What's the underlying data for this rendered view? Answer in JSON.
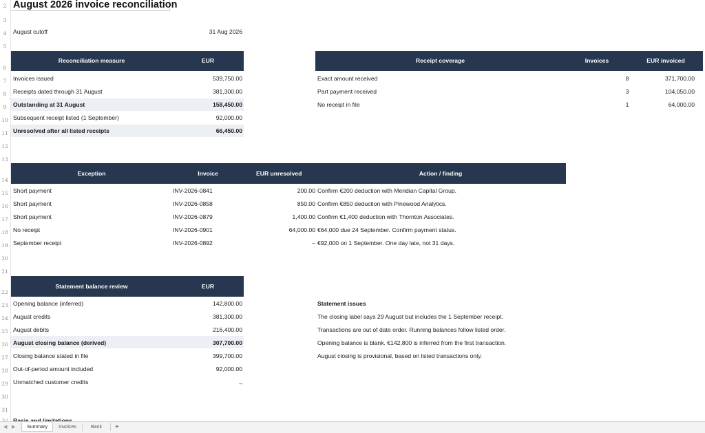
{
  "title": "August 2026 invoice reconciliation",
  "rows": [
    "2",
    "3",
    "4",
    "5",
    "6",
    "7",
    "8",
    "9",
    "10",
    "11",
    "12",
    "13",
    "14",
    "15",
    "16",
    "17",
    "18",
    "19",
    "20",
    "21",
    "22",
    "23",
    "24",
    "25",
    "26",
    "27",
    "28",
    "29",
    "30",
    "31",
    "32"
  ],
  "cutoff": {
    "label": "August cutoff",
    "value": "31 Aug 2026"
  },
  "recon": {
    "headers": {
      "measure": "Reconciliation measure",
      "eur": "EUR"
    },
    "rows": [
      {
        "label": "Invoices issued",
        "value": "539,750.00"
      },
      {
        "label": "Receipts dated through 31 August",
        "value": "381,300.00"
      },
      {
        "label": "Outstanding at 31 August",
        "value": "158,450.00"
      },
      {
        "label": "Subsequent receipt listed (1 September)",
        "value": "92,000.00"
      },
      {
        "label": "Unresolved after all listed receipts",
        "value": "66,450.00"
      }
    ]
  },
  "coverage": {
    "headers": {
      "title": "Receipt coverage",
      "invoices": "Invoices",
      "eur": "EUR invoiced"
    },
    "rows": [
      {
        "label": "Exact amount received",
        "count": "8",
        "value": "371,700.00"
      },
      {
        "label": "Part payment received",
        "count": "3",
        "value": "104,050.00"
      },
      {
        "label": "No receipt in file",
        "count": "1",
        "value": "64,000.00"
      }
    ]
  },
  "exceptions": {
    "headers": {
      "exception": "Exception",
      "invoice": "Invoice",
      "eur": "EUR unresolved",
      "action": "Action / finding"
    },
    "rows": [
      {
        "type": "Short payment",
        "invoice": "INV-2026-0841",
        "amount": "200.00",
        "action": "Confirm €200 deduction with Meridian Capital Group."
      },
      {
        "type": "Short payment",
        "invoice": "INV-2026-0858",
        "amount": "850.00",
        "action": "Confirm €850 deduction with Pinewood Analytics."
      },
      {
        "type": "Short payment",
        "invoice": "INV-2026-0879",
        "amount": "1,400.00",
        "action": "Confirm €1,400 deduction with Thornton Associates."
      },
      {
        "type": "No receipt",
        "invoice": "INV-2026-0901",
        "amount": "64,000.00",
        "action": "€64,000 due 24 September. Confirm payment status."
      },
      {
        "type": "September receipt",
        "invoice": "INV-2026-0892",
        "amount": "–",
        "action": "€92,000 on 1 September. One day late, not 31 days."
      }
    ]
  },
  "statement": {
    "headers": {
      "title": "Statement balance review",
      "eur": "EUR"
    },
    "rows": [
      {
        "label": "Opening balance (inferred)",
        "value": "142,800.00"
      },
      {
        "label": "August credits",
        "value": "381,300.00"
      },
      {
        "label": "August debits",
        "value": "216,400.00"
      },
      {
        "label": "August closing balance (derived)",
        "value": "307,700.00"
      },
      {
        "label": "Closing balance stated in file",
        "value": "399,700.00"
      },
      {
        "label": "Out-of-period amount included",
        "value": "92,000.00"
      },
      {
        "label": "Unmatched customer credits",
        "value": "–"
      }
    ]
  },
  "issues": {
    "title": "Statement issues",
    "items": [
      "The closing label says 29 August but includes the 1 September receipt.",
      "Transactions are out of date order. Running balances follow listed order.",
      "Opening balance is blank. €142,800 is inferred from the first transaction.",
      "August closing is provisional, based on listed transactions only."
    ]
  },
  "basis_title": "Basis and limitations",
  "tabs": {
    "items": [
      "Summary",
      "Invoices",
      "Bank"
    ],
    "active": "Summary",
    "add": "+"
  },
  "colors": {
    "header_bg": "#26374f",
    "header_text": "#ffffff",
    "highlight": "#eceff4"
  }
}
